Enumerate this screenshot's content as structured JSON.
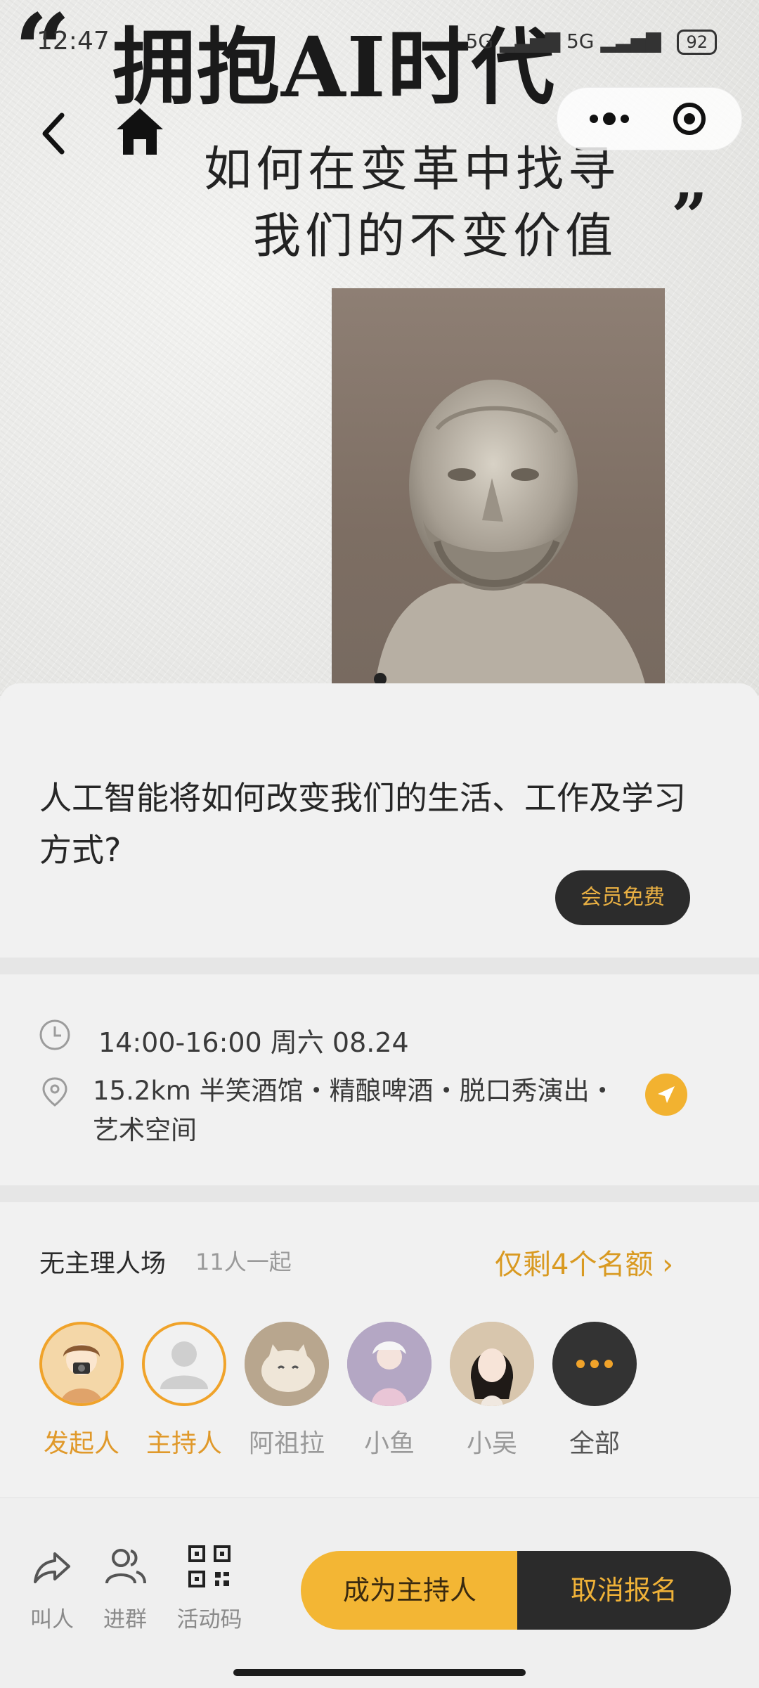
{
  "status_bar": {
    "time": "12:47",
    "network": "5G",
    "signal": "5G",
    "battery": "92"
  },
  "hero": {
    "quote_open": "“",
    "title": "拥抱AI时代",
    "subtitle_line1": "如何在变革中找寻",
    "subtitle_line2": "我们的不变价值",
    "quote_close": "”"
  },
  "event": {
    "title": "人工智能将如何改变我们的生活、工作及学习方式?",
    "price_badge": "会员免费",
    "time": "14:00-16:00 周六 08.24",
    "location": "15.2km 半笑酒馆・精酿啤酒・脱口秀演出・艺术空间"
  },
  "attendees": {
    "mode": "无主理人场",
    "count": "11人一起",
    "slots_link": "仅剩4个名额",
    "slots_chevron": "›",
    "items": [
      {
        "name": "发起人"
      },
      {
        "name": "主持人"
      },
      {
        "name": "阿祖拉"
      },
      {
        "name": "小鱼"
      },
      {
        "name": "小吴"
      },
      {
        "name": "全部"
      }
    ]
  },
  "bottom_bar": {
    "share_label": "叫人",
    "group_label": "进群",
    "qrcode_label": "活动码",
    "host_button": "成为主持人",
    "cancel_button": "取消报名"
  },
  "colors": {
    "accent": "#f3b634",
    "accent_text": "#d99a22",
    "dark": "#2b2b2b"
  }
}
